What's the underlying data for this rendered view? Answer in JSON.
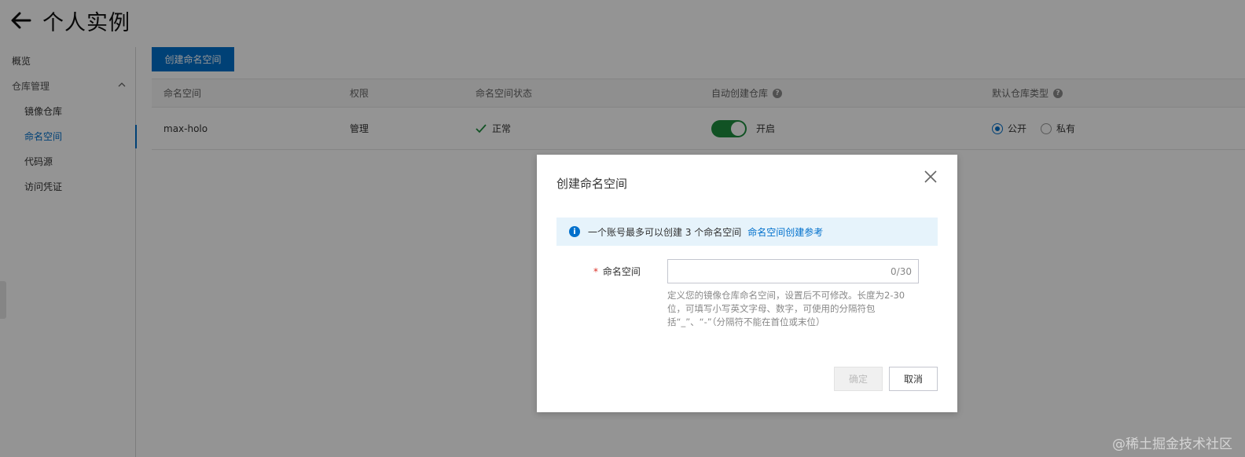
{
  "header": {
    "title": "个人实例",
    "back_icon": "arrow-left-icon"
  },
  "sidebar": {
    "items": [
      {
        "label": "概览"
      },
      {
        "label": "仓库管理",
        "expanded": true
      },
      {
        "label": "镜像仓库"
      },
      {
        "label": "命名空间",
        "active": true
      },
      {
        "label": "代码源"
      },
      {
        "label": "访问凭证"
      }
    ]
  },
  "toolbar": {
    "create_label": "创建命名空间"
  },
  "table": {
    "headers": [
      "命名空间",
      "权限",
      "命名空间状态",
      "自动创建仓库",
      "默认仓库类型"
    ],
    "rows": [
      {
        "namespace": "max-holo",
        "permission": "管理",
        "status": "正常",
        "auto_create": {
          "enabled": true,
          "label": "开启"
        },
        "default_type": {
          "options": [
            "公开",
            "私有"
          ],
          "selected": "公开"
        }
      }
    ]
  },
  "dialog": {
    "title": "创建命名空间",
    "notice_text": "一个账号最多可以创建 3 个命名空间",
    "notice_link": "命名空间创建参考",
    "field_required_mark": "*",
    "field_label": "命名空间",
    "field_value": "",
    "field_count": "0/30",
    "field_help": "定义您的镜像仓库命名空间，设置后不可修改。长度为2-30位，可填写小写英文字母、数字，可使用的分隔符包括“_”、“-”（分隔符不能在首位或末位）",
    "confirm_label": "确定",
    "cancel_label": "取消"
  },
  "watermark": "@稀土掘金技术社区",
  "colors": {
    "primary": "#0070cc",
    "toggle_on": "#1e8e3e",
    "notice_bg": "#e6f3fb"
  }
}
